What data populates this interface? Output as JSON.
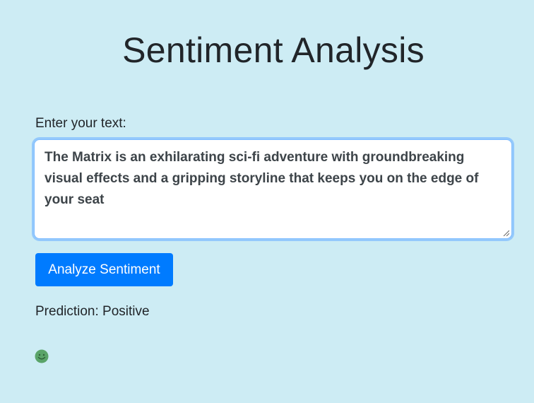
{
  "title": "Sentiment Analysis",
  "input": {
    "label": "Enter your text:",
    "value": "The Matrix is an exhilarating sci-fi adventure with groundbreaking visual effects and a gripping storyline that keeps you on the edge of your seat"
  },
  "button": {
    "label": "Analyze Sentiment"
  },
  "result": {
    "prediction": "Prediction: Positive",
    "icon": "smiley-face-icon",
    "icon_color": "#5aa469"
  },
  "colors": {
    "background": "#cdecf4",
    "accent": "#007bff",
    "focus_ring": "#80bdff"
  }
}
